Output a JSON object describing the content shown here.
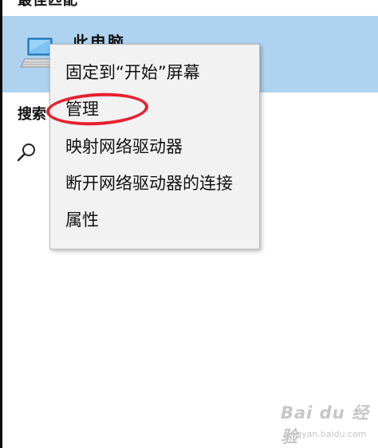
{
  "sections": {
    "best_match_header": "最佳匹配",
    "search_web_label": "搜索"
  },
  "best_match": {
    "title": "此电脑",
    "icon": "computer-icon"
  },
  "search_icon": "search-icon",
  "context_menu": {
    "items": [
      {
        "label": "固定到“开始”屏幕"
      },
      {
        "label": "管理"
      },
      {
        "label": "映射网络驱动器"
      },
      {
        "label": "断开网络驱动器的连接"
      },
      {
        "label": "属性"
      }
    ]
  },
  "annotation_color": "#e8202f",
  "colors": {
    "selected_background": "#aed3f0",
    "menu_background": "#f2f2f2"
  },
  "watermark": {
    "main": "Bai du 经验",
    "url": "jingyan.baidu.com"
  }
}
